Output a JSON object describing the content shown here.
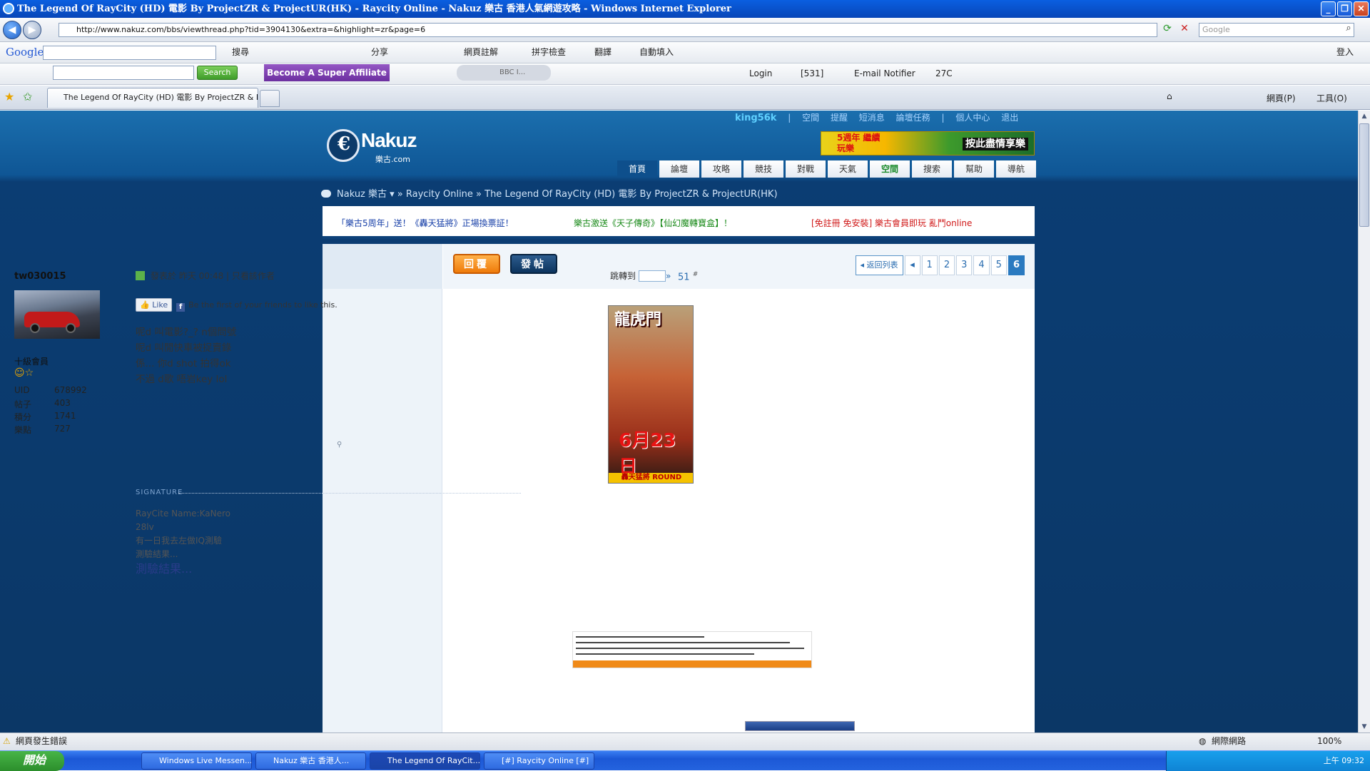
{
  "window": {
    "title": "The Legend Of RayCity (HD) 電影 By ProjectZR & ProjectUR(HK) - Raycity Online - Nakuz 樂古 香港人氣網遊攻略 - Windows Internet Explorer"
  },
  "browser": {
    "url": "http://www.nakuz.com/bbs/viewthread.php?tid=3904130&extra=&highlight=zr&page=6",
    "search_placeholder": "Google",
    "google_toolbar": {
      "logo": "Google",
      "items": [
        "搜尋",
        "分享",
        "網頁註解",
        "拼字檢查",
        "翻譯",
        "自動填入"
      ],
      "signin": "登入"
    },
    "toolbar2": {
      "search_btn": "Search",
      "affiliate": "Become A Super Affiliate",
      "radio": "BBC I...",
      "login": "Login",
      "count": "[531]",
      "email": "E-mail Notifier",
      "temp": "27C"
    },
    "tab_title": "The Legend Of RayCity (HD) 電影 By ProjectZR & Pr...",
    "cmd": {
      "page": "網頁(P)",
      "tools": "工具(O)"
    }
  },
  "site": {
    "usernav": [
      "king56k",
      "|",
      "空間",
      "提醒",
      "短消息",
      "論壇任務",
      "|",
      "個人中心",
      "退出"
    ],
    "logo_name": "Nakuz",
    "logo_domain": "樂古.com",
    "banner_left": "5週年 繼續玩樂",
    "banner_right": "按此盡情享樂",
    "nav": [
      "首頁",
      "論壇",
      "攻略",
      "競技",
      "對戰",
      "天氣",
      "空間",
      "搜索",
      "幫助",
      "導航"
    ],
    "breadcrumb": "Nakuz 樂古 ▾  »  Raycity Online  »  The Legend Of RayCity (HD) 電影 By ProjectZR & ProjectUR(HK)",
    "notices": [
      "「樂古5周年」送！《轟天猛將》正場換票証！",
      "樂古激送《天子傳奇》【仙幻魔轉寶盒】！",
      "[免註冊 免安裝] 樂古會員即玩 亂鬥online"
    ]
  },
  "thread": {
    "reply_btn": "回覆",
    "new_btn": "發帖",
    "pager": {
      "back": "◂ 返回列表",
      "prev": "◂",
      "pages": [
        "1",
        "2",
        "3",
        "4",
        "5"
      ],
      "current": "6"
    },
    "post": {
      "username": "tw030015",
      "rank": "十級會員",
      "stats": [
        {
          "label": "UID",
          "value": "678992"
        },
        {
          "label": "帖子",
          "value": "403"
        },
        {
          "label": "積分",
          "value": "1741"
        },
        {
          "label": "樂點",
          "value": "727"
        }
      ],
      "meta": "發表於 昨天 00:48  |  只看該作者",
      "jump_label": "跳轉到",
      "jump_arrow": "»",
      "floor": "51",
      "floor_sym": "#",
      "like_btn": "Like",
      "like_text": "Be the first of your friends to like this.",
      "message": [
        "呢d 叫電影?_? n個問號",
        "呢d 叫閒快車被捉賣錄",
        "係... 你d shot 拍得ok",
        "不過 d歌 唔岩key lol"
      ],
      "ad": {
        "title": "龍虎門",
        "date": "6月23日",
        "strip": "轟天猛將 ROUND"
      },
      "signature_label": "SIGNATURE",
      "signature": [
        "RayCite Name:KaNero",
        "28lv",
        "有一日我去左做IQ測驗",
        "測驗結果..."
      ],
      "signature_big": "測驗結果..."
    }
  },
  "status": {
    "left": "網頁發生錯誤",
    "zone": "網際網路",
    "zoom": "100%"
  },
  "taskbar": {
    "start": "開始",
    "tasks": [
      "Windows Live Messen...",
      "Nakuz 樂古 香港人...",
      "The Legend Of RayCit...",
      "[#] Raycity Online [#]"
    ],
    "clock": "上午 09:32"
  }
}
